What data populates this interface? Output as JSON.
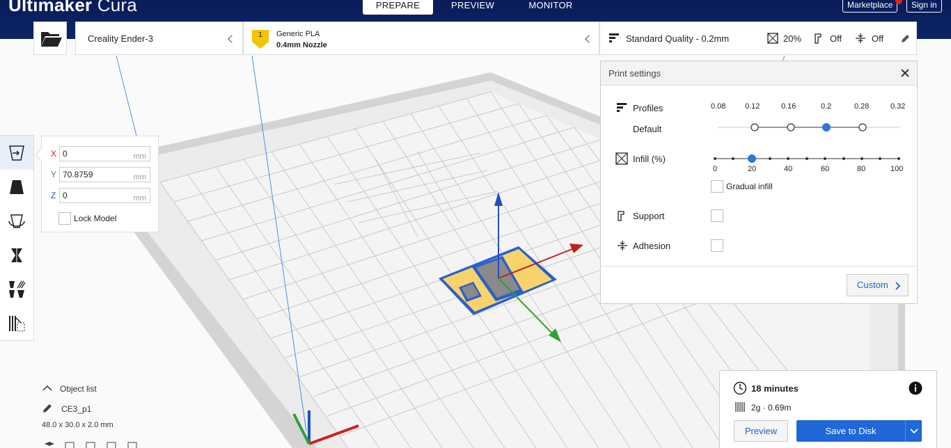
{
  "app": {
    "title_bold": "Ultimaker",
    "title_light": "Cura"
  },
  "stages": [
    {
      "label": "PREPARE",
      "active": true
    },
    {
      "label": "PREVIEW",
      "active": false
    },
    {
      "label": "MONITOR",
      "active": false
    }
  ],
  "header_buttons": {
    "marketplace": "Marketplace",
    "sign_in": "Sign in"
  },
  "printer": {
    "name": "Creality Ender-3"
  },
  "material": {
    "extruder_index": "1",
    "name": "Generic PLA",
    "nozzle": "0.4mm Nozzle",
    "badge_color": "#f5c400"
  },
  "quality": {
    "profile": "Standard Quality - 0.2mm",
    "infill": "20%",
    "support": "Off",
    "adhesion": "Off"
  },
  "move_tool": {
    "x_label": "X",
    "x_value": "0",
    "y_label": "Y",
    "y_value": "70.8759",
    "z_label": "Z",
    "z_value": "0",
    "unit": "mm",
    "lock_model": "Lock Model",
    "x_color": "#d02020",
    "y_color": "#30a030",
    "z_color": "#2050c0"
  },
  "print_settings": {
    "title": "Print settings",
    "profiles_label": "Profiles",
    "profile_name": "Default",
    "layer_heights": [
      "0.08",
      "0.12",
      "0.16",
      "0.2",
      "0.28",
      "0.32"
    ],
    "selected_layer_height": "0.2",
    "infill_label": "Infill (%)",
    "infill_ticks": [
      "0",
      "20",
      "40",
      "60",
      "80",
      "100"
    ],
    "infill_value": 20,
    "gradual_infill": "Gradual infill",
    "support_label": "Support",
    "adhesion_label": "Adhesion",
    "custom_button": "Custom"
  },
  "object_list": {
    "toggle": "Object list",
    "object_name": "CE3_p1",
    "dimensions": "48.0 x 30.0 x 2.0 mm"
  },
  "job": {
    "time": "18 minutes",
    "material_usage": "2g · 0.69m",
    "preview_button": "Preview",
    "save_button": "Save to Disk",
    "accent_color": "#2067d7"
  }
}
